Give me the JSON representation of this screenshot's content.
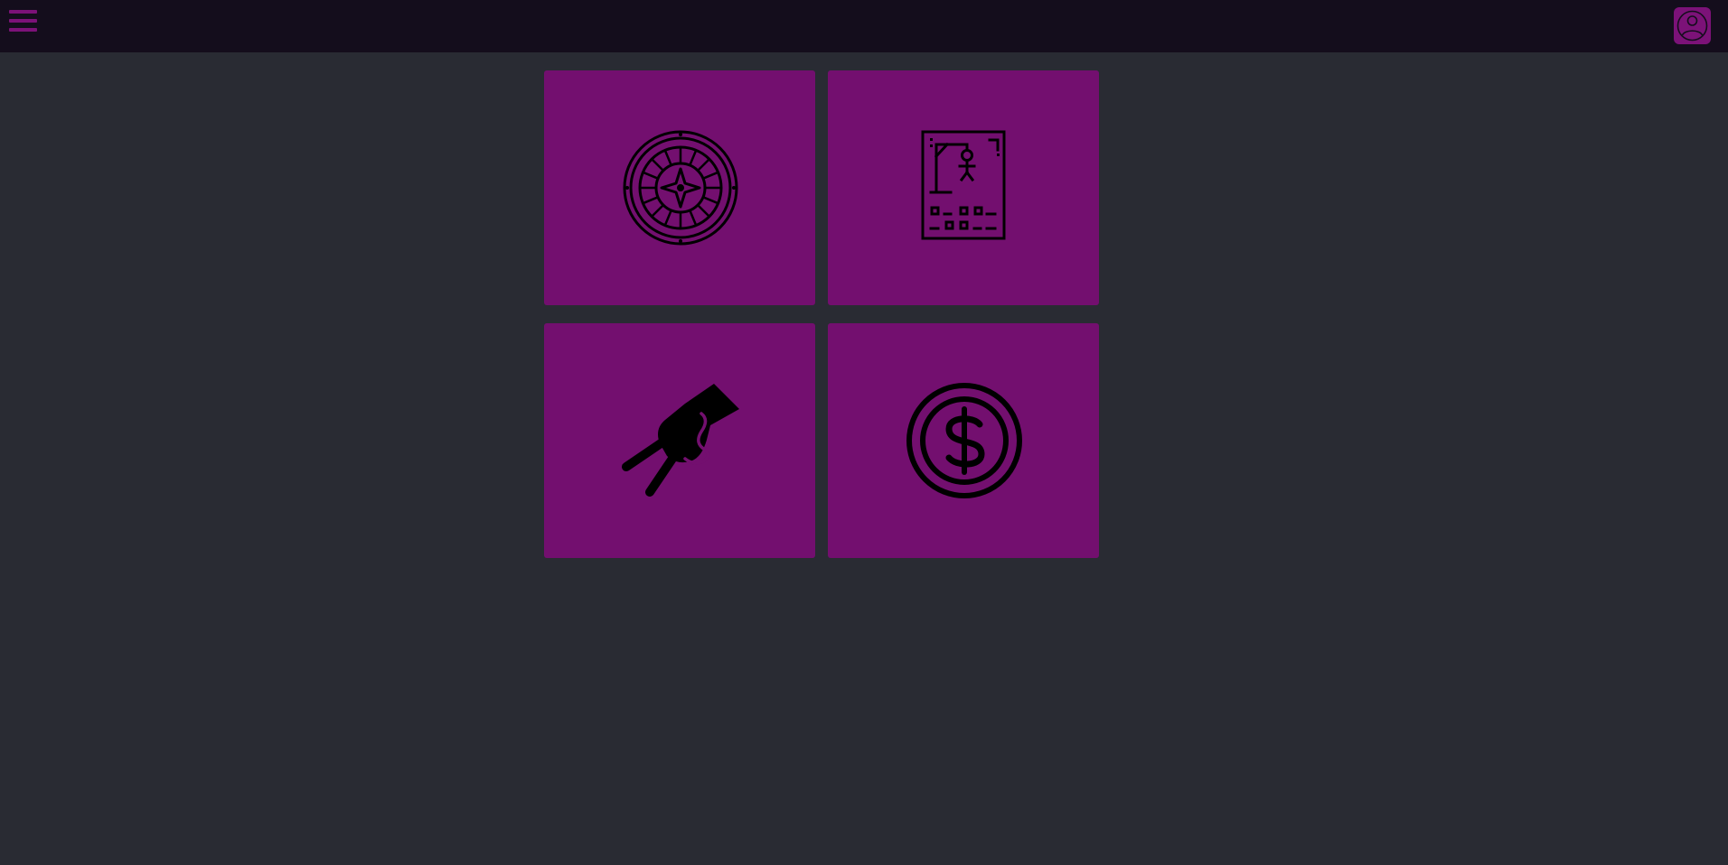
{
  "header": {
    "menu_icon": "hamburger-menu-icon",
    "avatar_icon": "user-avatar-icon"
  },
  "tiles": [
    {
      "icon": "roulette-wheel-icon"
    },
    {
      "icon": "hangman-game-icon"
    },
    {
      "icon": "hand-holding-card-icon"
    },
    {
      "icon": "dollar-coin-icon"
    }
  ],
  "colors": {
    "topbar": "#140d1c",
    "background": "#292b33",
    "tile": "#730f6f",
    "accent": "#7c1278",
    "icon": "#000000"
  }
}
